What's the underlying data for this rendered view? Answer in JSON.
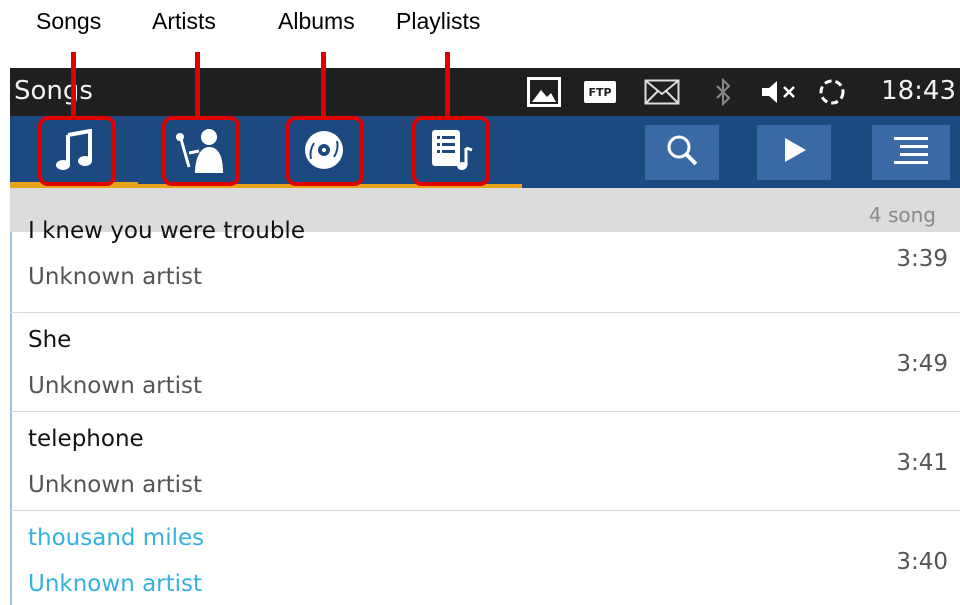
{
  "callouts": {
    "songs": "Songs",
    "artists": "Artists",
    "albums": "Albums",
    "playlists": "Playlists"
  },
  "status_bar": {
    "title": "Songs",
    "ftp_label": "FTP",
    "time": "18:43",
    "icons": [
      "image-icon",
      "ftp-icon",
      "mail-icon",
      "bluetooth-icon",
      "muted-volume-icon",
      "sync-icon"
    ]
  },
  "tabs": [
    {
      "name": "songs",
      "icon": "music-note-icon",
      "selected": true
    },
    {
      "name": "artists",
      "icon": "singer-icon",
      "selected": false
    },
    {
      "name": "albums",
      "icon": "disc-icon",
      "selected": false
    },
    {
      "name": "playlists",
      "icon": "playlist-icon",
      "selected": false
    }
  ],
  "actions": [
    "search-icon",
    "play-icon",
    "menu-icon"
  ],
  "song_count": "4 song",
  "songs": [
    {
      "title": "I knew you were trouble",
      "artist": "Unknown artist",
      "duration": "3:39"
    },
    {
      "title": "She",
      "artist": "Unknown artist",
      "duration": "3:49"
    },
    {
      "title": "telephone",
      "artist": "Unknown artist",
      "duration": "3:41"
    },
    {
      "title": "thousand miles",
      "artist": "Unknown artist",
      "duration": "3:40",
      "active": true
    }
  ],
  "colors": {
    "action_bar": "#1c4a80",
    "accent_underline": "#e8a319",
    "callout_red": "#e00000",
    "active_song": "#34b1e0"
  }
}
